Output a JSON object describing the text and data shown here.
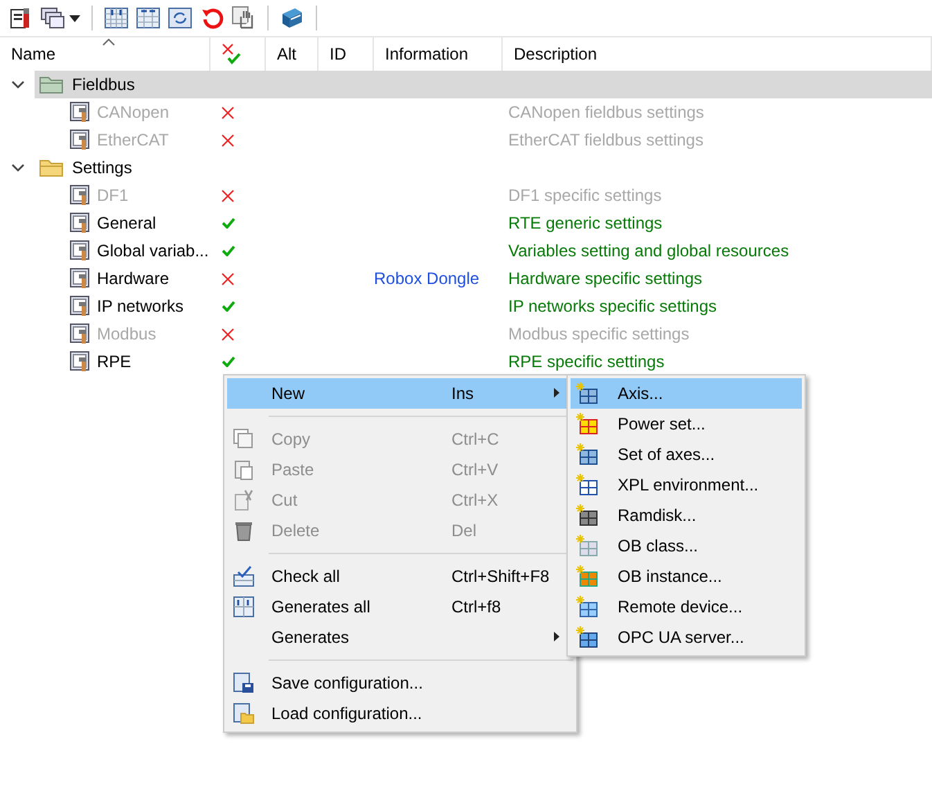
{
  "table": {
    "columns": [
      {
        "kind": "text",
        "label": "Name"
      },
      {
        "kind": "status"
      },
      {
        "kind": "text",
        "label": "Alt"
      },
      {
        "kind": "text",
        "label": "ID"
      },
      {
        "kind": "text",
        "label": "Information"
      },
      {
        "kind": "text",
        "label": "Description"
      }
    ],
    "groups": [
      {
        "label": "Fieldbus",
        "expanded": true,
        "selected": true,
        "children": [
          {
            "name": "CANopen",
            "enabled": false,
            "valid": false,
            "description": "CANopen fieldbus settings"
          },
          {
            "name": "EtherCAT",
            "enabled": false,
            "valid": false,
            "description": "EtherCAT fieldbus settings"
          }
        ]
      },
      {
        "label": "Settings",
        "expanded": true,
        "selected": false,
        "children": [
          {
            "name": "DF1",
            "enabled": false,
            "valid": false,
            "description": "DF1 specific settings"
          },
          {
            "name": "General",
            "enabled": true,
            "valid": true,
            "description": "RTE generic settings"
          },
          {
            "name": "Global variab...",
            "enabled": true,
            "valid": true,
            "description": "Variables setting and global resources"
          },
          {
            "name": "Hardware",
            "enabled": true,
            "valid": false,
            "information": "Robox Dongle",
            "description": "Hardware specific settings"
          },
          {
            "name": "IP networks",
            "enabled": true,
            "valid": true,
            "description": "IP networks specific settings"
          },
          {
            "name": "Modbus",
            "enabled": false,
            "valid": false,
            "description": "Modbus specific settings"
          },
          {
            "name": "RPE",
            "enabled": true,
            "valid": true,
            "description": "RPE specific settings"
          }
        ]
      }
    ]
  },
  "context_menu": {
    "items": [
      {
        "kind": "item",
        "label": "New",
        "shortcut": "Ins",
        "submenu": true,
        "selected": true,
        "disabled": false
      },
      {
        "kind": "separator"
      },
      {
        "kind": "item",
        "label": "Copy",
        "shortcut": "Ctrl+C",
        "submenu": false,
        "selected": false,
        "disabled": true
      },
      {
        "kind": "item",
        "label": "Paste",
        "shortcut": "Ctrl+V",
        "submenu": false,
        "selected": false,
        "disabled": true
      },
      {
        "kind": "item",
        "label": "Cut",
        "shortcut": "Ctrl+X",
        "submenu": false,
        "selected": false,
        "disabled": true
      },
      {
        "kind": "item",
        "label": "Delete",
        "shortcut": "Del",
        "submenu": false,
        "selected": false,
        "disabled": true
      },
      {
        "kind": "separator"
      },
      {
        "kind": "item",
        "label": "Check all",
        "shortcut": "Ctrl+Shift+F8",
        "submenu": false,
        "selected": false,
        "disabled": false
      },
      {
        "kind": "item",
        "label": "Generates all",
        "shortcut": "Ctrl+f8",
        "submenu": false,
        "selected": false,
        "disabled": false
      },
      {
        "kind": "item",
        "label": "Generates",
        "submenu": true,
        "selected": false,
        "disabled": false
      },
      {
        "kind": "separator"
      },
      {
        "kind": "item",
        "label": "Save configuration...",
        "submenu": false,
        "selected": false,
        "disabled": false
      },
      {
        "kind": "item",
        "label": "Load configuration...",
        "submenu": false,
        "selected": false,
        "disabled": false
      }
    ]
  },
  "submenu": {
    "items": [
      {
        "label": "Axis...",
        "selected": true
      },
      {
        "label": "Power set...",
        "selected": false
      },
      {
        "label": "Set of axes...",
        "selected": false
      },
      {
        "label": "XPL environment...",
        "selected": false
      },
      {
        "label": "Ramdisk...",
        "selected": false
      },
      {
        "label": "OB class...",
        "selected": false
      },
      {
        "label": "OB instance...",
        "selected": false
      },
      {
        "label": "Remote device...",
        "selected": false
      },
      {
        "label": "OPC UA server...",
        "selected": false
      }
    ]
  }
}
